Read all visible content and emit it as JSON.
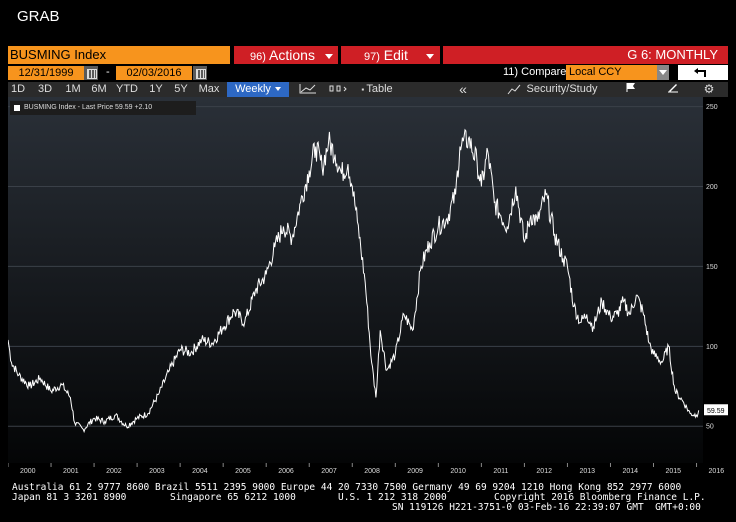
{
  "window": {
    "title": "GRAB"
  },
  "header": {
    "ticker": "BUSMING Index",
    "actions": {
      "num": "96)",
      "label": "Actions"
    },
    "edit": {
      "num": "97)",
      "label": "Edit"
    },
    "chart_mode": "G 6: MONTHLY"
  },
  "dates": {
    "start": "12/31/1999",
    "dash": "-",
    "end": "02/03/2016"
  },
  "compare": {
    "label": "11) Compare",
    "currency": "Local CCY"
  },
  "toolbar": {
    "periods": [
      "1D",
      "3D",
      "1M",
      "6M",
      "YTD",
      "1Y",
      "5Y",
      "Max"
    ],
    "frequency": "Weekly",
    "table_label": "Table",
    "security_study": "Security/Study"
  },
  "legend": {
    "text": "BUSMING Index - Last Price 59.59  +2.10"
  },
  "chart_data": {
    "type": "line",
    "series": [
      {
        "name": "BUSMING Index - Last Price",
        "x": [
          2000.0,
          2000.08,
          2000.25,
          2000.5,
          2000.75,
          2001.0,
          2001.25,
          2001.45,
          2001.55,
          2001.75,
          2002.0,
          2002.25,
          2002.5,
          2002.75,
          2003.0,
          2003.25,
          2003.5,
          2003.75,
          2004.0,
          2004.25,
          2004.5,
          2004.75,
          2005.0,
          2005.25,
          2005.5,
          2005.75,
          2006.0,
          2006.2,
          2006.4,
          2006.6,
          2006.8,
          2007.0,
          2007.15,
          2007.3,
          2007.45,
          2007.6,
          2007.75,
          2007.9,
          2008.0,
          2008.12,
          2008.3,
          2008.45,
          2008.55,
          2008.65,
          2008.8,
          2009.0,
          2009.2,
          2009.4,
          2009.6,
          2009.8,
          2010.0,
          2010.2,
          2010.4,
          2010.5,
          2010.7,
          2010.9,
          2011.0,
          2011.15,
          2011.3,
          2011.45,
          2011.6,
          2011.8,
          2012.0,
          2012.15,
          2012.3,
          2012.5,
          2012.7,
          2012.9,
          2013.0,
          2013.15,
          2013.3,
          2013.45,
          2013.6,
          2013.8,
          2014.0,
          2014.15,
          2014.3,
          2014.45,
          2014.6,
          2014.75,
          2014.9,
          2015.0,
          2015.2,
          2015.35,
          2015.5,
          2015.7,
          2015.85,
          2016.0,
          2016.05
        ],
        "y": [
          104,
          90,
          82,
          75,
          80,
          72,
          76,
          68,
          52,
          48,
          55,
          53,
          57,
          50,
          55,
          58,
          70,
          85,
          98,
          96,
          104,
          102,
          112,
          122,
          115,
          135,
          145,
          162,
          175,
          168,
          190,
          210,
          225,
          212,
          228,
          220,
          208,
          214,
          200,
          178,
          140,
          90,
          68,
          110,
          85,
          95,
          120,
          110,
          150,
          165,
          175,
          180,
          195,
          225,
          230,
          215,
          200,
          222,
          190,
          182,
          175,
          200,
          165,
          182,
          178,
          195,
          170,
          155,
          150,
          125,
          115,
          120,
          112,
          128,
          118,
          120,
          128,
          120,
          132,
          122,
          102,
          95,
          90,
          100,
          72,
          65,
          58,
          57,
          60
        ]
      }
    ],
    "x_ticks": [
      "2000",
      "2001",
      "2002",
      "2003",
      "2004",
      "2005",
      "2006",
      "2007",
      "2008",
      "2009",
      "2010",
      "2011",
      "2012",
      "2013",
      "2014",
      "2015",
      "2016"
    ],
    "y_ticks": [
      50,
      100,
      150,
      200,
      250
    ],
    "xlim": [
      2000,
      2016.15
    ],
    "ylim": [
      27,
      256
    ],
    "last_value_label": "59.59",
    "grid": true
  },
  "footer": {
    "line1": "Australia 61 2 9777 8600 Brazil 5511 2395 9000 Europe 44 20 7330 7500 Germany 49 69 9204 1210 Hong Kong 852 2977 6000",
    "line2a": "Japan 81 3 3201 8900",
    "line2b": "Singapore 65 6212 1000",
    "line2c": "U.S. 1 212 318 2000",
    "line2d": "Copyright 2016 Bloomberg Finance L.P.",
    "line3": "SN 119126 H221-3751-0 03-Feb-16 22:39:07 GMT  GMT+0:00"
  },
  "colors": {
    "ticker_bg": "#f7941d",
    "menu_bg": "#cf1f25",
    "selected": "#2d68c4",
    "series": "#ffffff"
  }
}
